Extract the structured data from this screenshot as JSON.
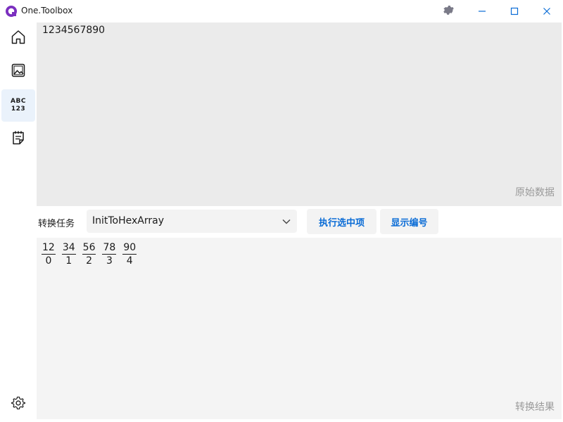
{
  "window": {
    "title": "One.Toolbox",
    "buttons": [
      "gear-icon",
      "minimize-icon",
      "maximize-icon",
      "close-icon"
    ]
  },
  "sidebar": {
    "items": [
      {
        "name": "home",
        "icon": "home-icon"
      },
      {
        "name": "image",
        "icon": "image-icon"
      },
      {
        "name": "abc123",
        "icon": "abc-123-icon",
        "label_top": "ABC",
        "label_bottom": "123",
        "selected": true
      },
      {
        "name": "notes",
        "icon": "notepad-icon"
      }
    ],
    "footer": {
      "name": "settings",
      "icon": "gear-icon"
    }
  },
  "input": {
    "value": "1234567890",
    "hint": "原始数据"
  },
  "toolbar": {
    "task_label": "转换任务",
    "task_value": "InitToHexArray",
    "run_label": "执行选中项",
    "show_label": "显示编号"
  },
  "output": {
    "tokens": [
      {
        "value": "12",
        "index": "0"
      },
      {
        "value": "34",
        "index": "1"
      },
      {
        "value": "56",
        "index": "2"
      },
      {
        "value": "78",
        "index": "3"
      },
      {
        "value": "90",
        "index": "4"
      }
    ],
    "hint": "转换结果"
  },
  "colors": {
    "accent": "#0a6cd6",
    "brand": "#7b2fbf",
    "selected_nav": "#eaf2fb",
    "input_bg": "#ebebeb",
    "output_bg": "#f4f4f4"
  }
}
